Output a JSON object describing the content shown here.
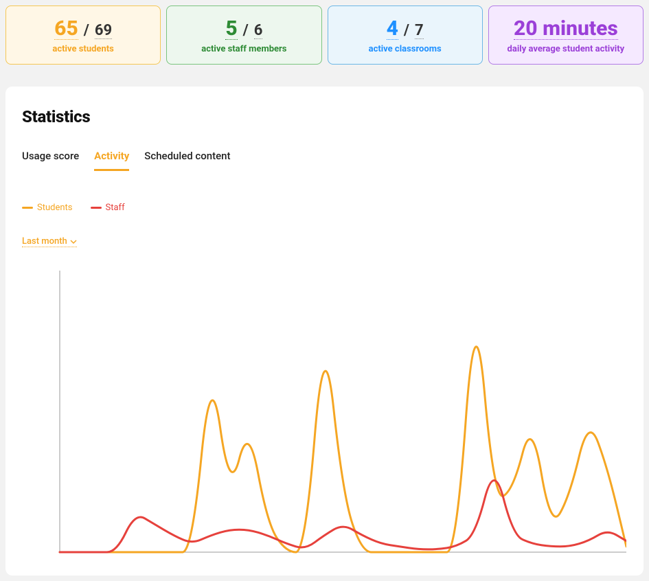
{
  "cards": [
    {
      "theme": "orange",
      "value": "65",
      "total": "69",
      "caption": "active students"
    },
    {
      "theme": "green",
      "value": "5",
      "total": "6",
      "caption": "active staff members"
    },
    {
      "theme": "blue",
      "value": "4",
      "total": "7",
      "caption": "active classrooms"
    },
    {
      "theme": "purple",
      "value": "20 minutes",
      "total": null,
      "caption": "daily average student activity"
    }
  ],
  "panel": {
    "title": "Statistics",
    "tabs": [
      "Usage score",
      "Activity",
      "Scheduled content"
    ],
    "active_tab": "Activity",
    "legend": {
      "students": {
        "label": "Students",
        "color": "#f5a623"
      },
      "staff": {
        "label": "Staff",
        "color": "#e6413c"
      }
    },
    "range": "Last month"
  },
  "chart_data": {
    "type": "line",
    "title": "Statistics — Activity",
    "xlabel": "",
    "ylabel": "",
    "ylim": [
      0,
      100
    ],
    "x": [
      0,
      1,
      2,
      3,
      4,
      5,
      6,
      7,
      8,
      9,
      10,
      11,
      12,
      13,
      14,
      15,
      16,
      17,
      18,
      19,
      20,
      21,
      22,
      23,
      24,
      25,
      26,
      27,
      28,
      29,
      30
    ],
    "series": [
      {
        "name": "Students",
        "color": "#f5a623",
        "values": [
          0,
          0,
          0,
          0,
          0,
          0,
          0,
          0,
          68,
          20,
          46,
          10,
          0,
          0,
          82,
          20,
          0,
          0,
          0,
          0,
          0,
          0,
          94,
          18,
          22,
          48,
          8,
          20,
          48,
          30,
          2
        ]
      },
      {
        "name": "Staff",
        "color": "#e6413c",
        "values": [
          0,
          0,
          0,
          0,
          14,
          10,
          6,
          3,
          6,
          8,
          8,
          6,
          3,
          1,
          6,
          10,
          6,
          3,
          2,
          1,
          1,
          2,
          6,
          32,
          6,
          3,
          2,
          2,
          4,
          8,
          4
        ]
      }
    ]
  }
}
